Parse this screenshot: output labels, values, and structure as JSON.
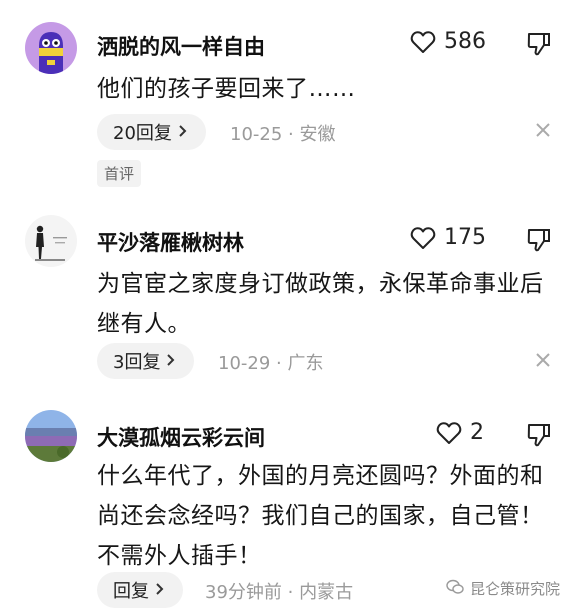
{
  "comments": [
    {
      "username": "洒脱的风一样自由",
      "likes": "586",
      "content": "他们的孩子要回来了……",
      "reply_label": "20回复",
      "meta": "10-25 · 安徽",
      "badge": "首评"
    },
    {
      "username": "平沙落雁楸树林",
      "likes": "175",
      "content": "为官宦之家度身订做政策，永保革命事业后继有人。",
      "reply_label": "3回复",
      "meta": "10-29 · 广东"
    },
    {
      "username": "大漠孤烟云彩云间",
      "likes": "2",
      "content": "什么年代了，外国的月亮还圆吗？外面的和尚还会念经吗？我们自己的国家，自己管！不需外人插手！",
      "reply_label": "回复",
      "meta": "39分钟前 · 内蒙古"
    }
  ],
  "watermark": "昆仑策研究院",
  "icons": {
    "like": "heart-icon",
    "dislike": "thumbs-down-icon",
    "close": "close-icon",
    "chevron": "chevron-right-icon",
    "watermark": "wechat-icon"
  }
}
